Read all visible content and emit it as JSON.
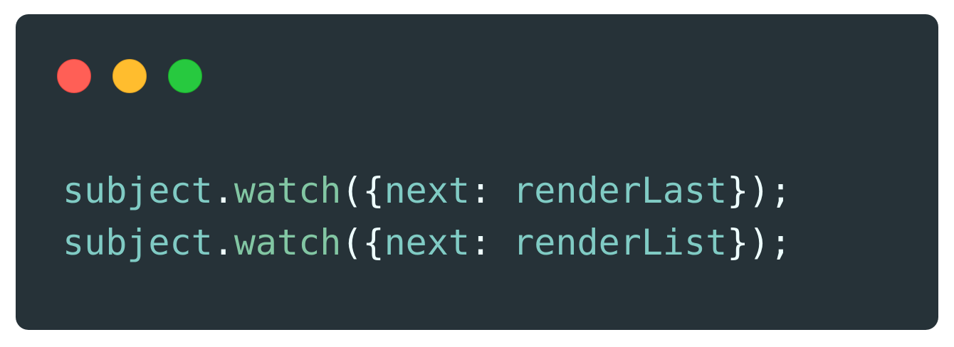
{
  "window": {
    "buttons": [
      {
        "name": "close",
        "color": "#ff5f56"
      },
      {
        "name": "minimize",
        "color": "#ffbd2e"
      },
      {
        "name": "maximize",
        "color": "#27c93f"
      }
    ],
    "background": "#263238"
  },
  "code": {
    "lines": [
      {
        "object": "subject",
        "dot": ".",
        "method": "watch",
        "open": "(",
        "brace_open": "{",
        "key": "next",
        "colon": ": ",
        "value": "renderLast",
        "brace_close": "}",
        "close": ");"
      },
      {
        "object": "subject",
        "dot": ".",
        "method": "watch",
        "open": "(",
        "brace_open": "{",
        "key": "next",
        "colon": ": ",
        "value": "renderList",
        "brace_close": "}",
        "close": ");"
      }
    ]
  }
}
